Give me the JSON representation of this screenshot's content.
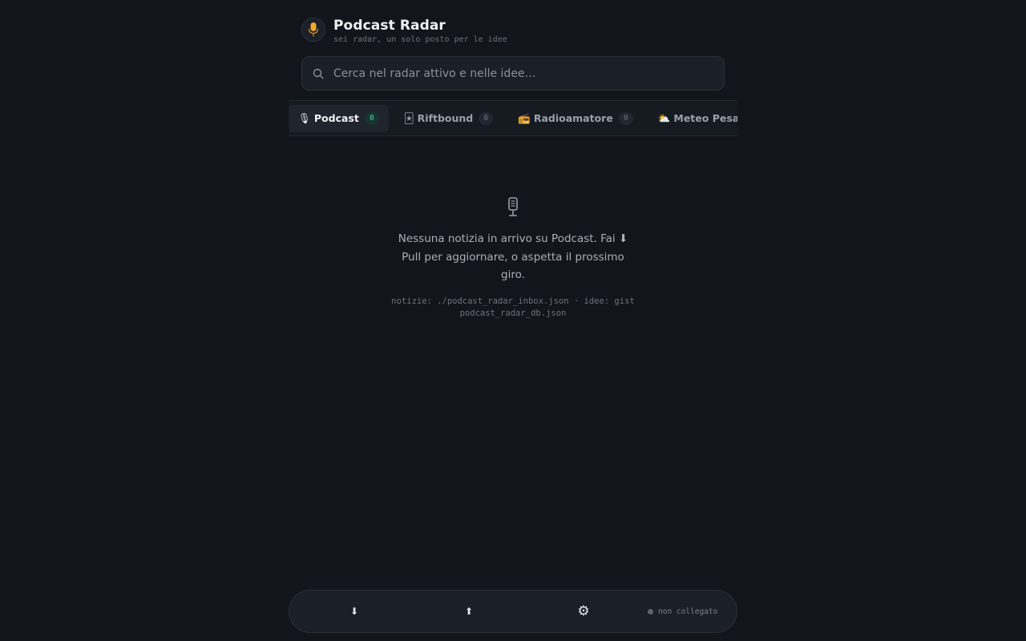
{
  "header": {
    "title": "Podcast Radar",
    "subtitle": "sei radar, un solo posto per le idee",
    "logo_icon": "microphone-icon"
  },
  "search": {
    "placeholder": "Cerca nel radar attivo e nelle idee…",
    "value": ""
  },
  "tabs": [
    {
      "emoji": "🎙",
      "label": "Podcast",
      "count": "0",
      "active": true
    },
    {
      "emoji": "🃏",
      "label": "Riftbound",
      "count": "0",
      "active": false
    },
    {
      "emoji": "📻",
      "label": "Radioamatore",
      "count": "0",
      "active": false
    },
    {
      "emoji": "⛅",
      "label": "Meteo Pesaro",
      "count": "",
      "active": false
    }
  ],
  "empty_state": {
    "icon": "microphone-icon",
    "message": "Nessuna notizia in arrivo su Podcast. Fai ⬇ Pull per aggiornare, o aspetta il prossimo giro.",
    "sources": "notizie: ./podcast_radar_inbox.json · idee: gist podcast_radar_db.json"
  },
  "bottom_bar": {
    "pull_glyph": "⬇",
    "push_glyph": "⬆",
    "settings_glyph": "⚙",
    "status_text": "non collegato"
  },
  "colors": {
    "background": "#12151b",
    "accent_count": "#4fd1b5",
    "logo_accent": "#f0a830"
  }
}
